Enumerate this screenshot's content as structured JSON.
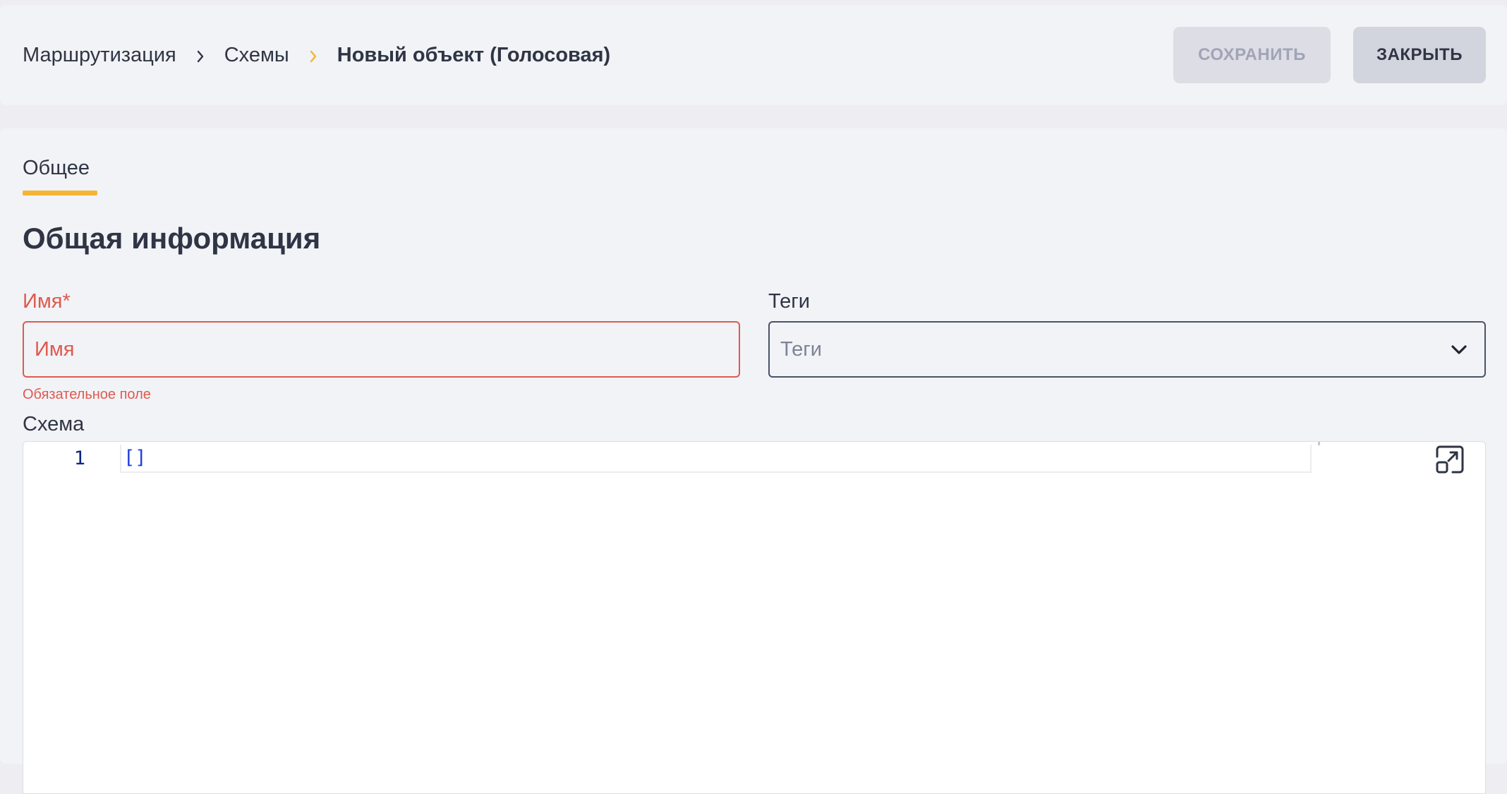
{
  "breadcrumb": {
    "items": [
      "Маршрутизация",
      "Схемы"
    ],
    "current": "Новый объект (Голосовая)",
    "accent_color": "#f5b433"
  },
  "toolbar": {
    "save_label": "СОХРАНИТЬ",
    "close_label": "ЗАКРЫТЬ"
  },
  "tabs": [
    {
      "label": "Общее",
      "active": true
    }
  ],
  "section": {
    "title": "Общая информация"
  },
  "form": {
    "name": {
      "label": "Имя*",
      "placeholder": "Имя",
      "value": "",
      "error": "Обязательное поле",
      "error_color": "#de5a4e"
    },
    "tags": {
      "label": "Теги",
      "placeholder": "Теги",
      "icon": "chevron-down-icon"
    },
    "schema": {
      "label": "Схема",
      "line_numbers": [
        "1"
      ],
      "code": "[]",
      "expand_icon": "open-in-new-icon"
    }
  }
}
